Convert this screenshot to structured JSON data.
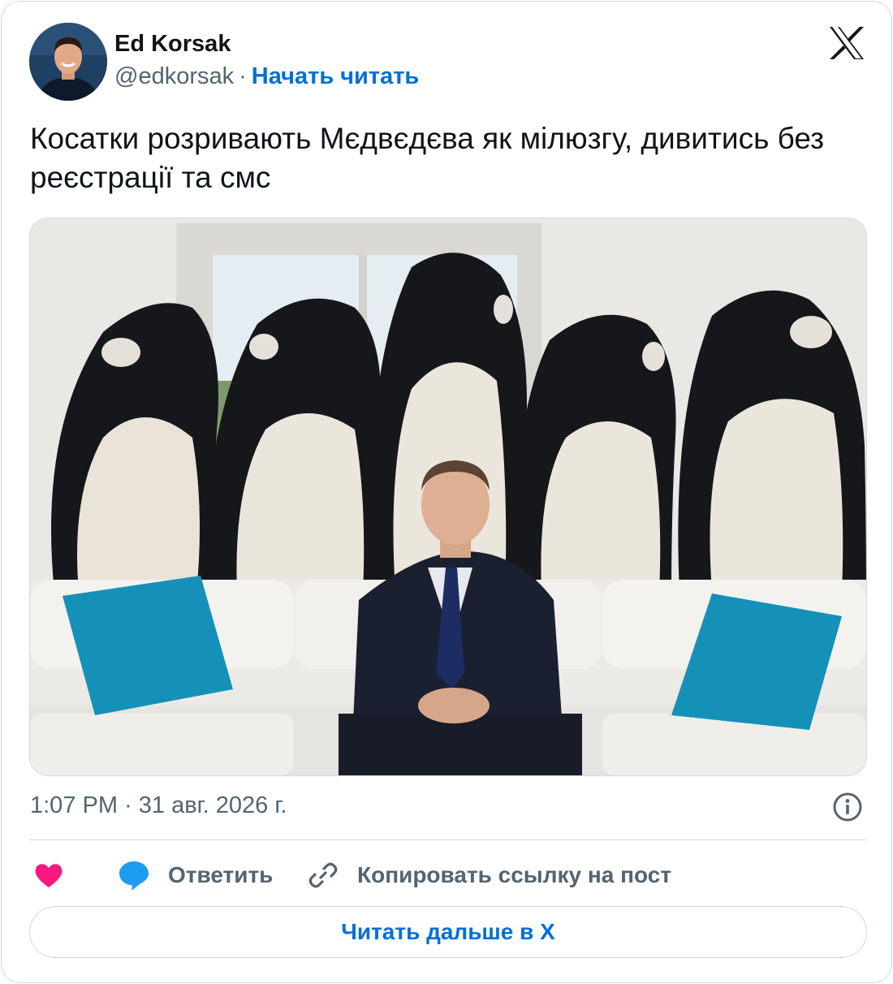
{
  "author": {
    "name": "Ed Korsak",
    "handle": "@edkorsak",
    "separator": "·",
    "follow_label": "Начать читать"
  },
  "tweet": {
    "text": "Косатки розривають Мєдвєдєва як мілюзгу, дивитись без реєстрації та смс",
    "timestamp": "1:07 PM · 31 авг. 2026 г."
  },
  "actions": {
    "reply_label": "Ответить",
    "copy_link_label": "Копировать ссылку на пост"
  },
  "read_more_label": "Читать дальше в X",
  "icons": {
    "logo": "x-logo-icon",
    "info": "info-icon",
    "like": "heart-icon",
    "reply": "speech-bubble-icon",
    "copy": "link-icon"
  },
  "colors": {
    "link": "#006fd6",
    "like": "#f91880",
    "reply": "#1d9bf0",
    "muted": "#536471",
    "border": "#cfd9de",
    "pillow": "#1591b8"
  }
}
